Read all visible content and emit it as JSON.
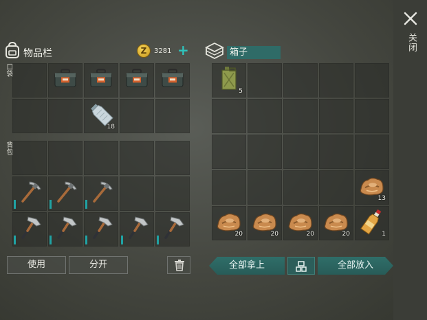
{
  "inventory": {
    "title": "物品栏",
    "coins": "3281",
    "pocket_label": "口袋",
    "backpack_label": "背包",
    "pocket_rows": [
      [
        {
          "item": ""
        },
        {
          "item": "toolbox-icon"
        },
        {
          "item": "toolbox-icon"
        },
        {
          "item": "toolbox-icon"
        },
        {
          "item": "toolbox-icon"
        }
      ],
      [
        {
          "item": ""
        },
        {
          "item": ""
        },
        {
          "item": "water-bottle-icon",
          "count": "18"
        },
        {
          "item": ""
        },
        {
          "item": ""
        }
      ]
    ],
    "backpack_rows": [
      [
        {
          "item": ""
        },
        {
          "item": ""
        },
        {
          "item": ""
        },
        {
          "item": ""
        },
        {
          "item": ""
        }
      ],
      [
        {
          "item": "pickaxe-icon"
        },
        {
          "item": "pickaxe-icon"
        },
        {
          "item": "pickaxe-icon"
        },
        {
          "item": ""
        },
        {
          "item": ""
        }
      ],
      [
        {
          "item": "hatchet-icon"
        },
        {
          "item": "hatchet-icon"
        },
        {
          "item": "hatchet-icon"
        },
        {
          "item": "hatchet-icon"
        },
        {
          "item": "hatchet-icon"
        }
      ]
    ],
    "use_label": "使用",
    "split_label": "分开"
  },
  "box": {
    "title": "箱子",
    "rows": [
      [
        {
          "item": "jerrycan-icon",
          "count": "5"
        },
        {
          "item": ""
        },
        {
          "item": ""
        },
        {
          "item": ""
        },
        {
          "item": ""
        }
      ],
      [
        {
          "item": ""
        },
        {
          "item": ""
        },
        {
          "item": ""
        },
        {
          "item": ""
        },
        {
          "item": ""
        }
      ],
      [
        {
          "item": ""
        },
        {
          "item": ""
        },
        {
          "item": ""
        },
        {
          "item": ""
        },
        {
          "item": ""
        }
      ],
      [
        {
          "item": ""
        },
        {
          "item": ""
        },
        {
          "item": ""
        },
        {
          "item": ""
        },
        {
          "item": "leather-pile-icon",
          "count": "13"
        }
      ],
      [
        {
          "item": "leather-pile-icon",
          "count": "20"
        },
        {
          "item": "leather-pile-icon",
          "count": "20"
        },
        {
          "item": "leather-pile-icon",
          "count": "20"
        },
        {
          "item": "leather-pile-icon",
          "count": "20"
        },
        {
          "item": "bottle-icon",
          "count": "1"
        }
      ]
    ],
    "take_all_label": "全部拿上",
    "put_all_label": "全部放入"
  },
  "close_label": "关闭",
  "colors": {
    "accent": "#2f6b67",
    "teal": "#20a3a4",
    "coin": "#e6b83a"
  }
}
